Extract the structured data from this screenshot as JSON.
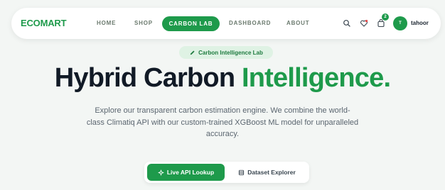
{
  "brand": {
    "part1": "ECO",
    "part2": "MART"
  },
  "nav": {
    "home": "HOME",
    "shop": "SHOP",
    "carbon_lab": "CARBON LAB",
    "dashboard": "DASHBOARD",
    "about": "ABOUT"
  },
  "header": {
    "cart_count": "2",
    "avatar_initial": "T",
    "username": "tahoor"
  },
  "hero": {
    "badge": "Carbon Intelligence Lab",
    "title_main": "Hybrid Carbon ",
    "title_accent": "Intelligence.",
    "description_line1": "Explore our transparent carbon estimation engine. We combine the world-",
    "description_line2": "class Climatiq API with our custom-trained XGBoost ML model for unparalleled",
    "description_line3": "accuracy."
  },
  "actions": {
    "live_api": "Live API Lookup",
    "dataset": "Dataset Explorer"
  },
  "colors": {
    "accent": "#1e9a4b",
    "badge_bg": "#dff2e4"
  }
}
